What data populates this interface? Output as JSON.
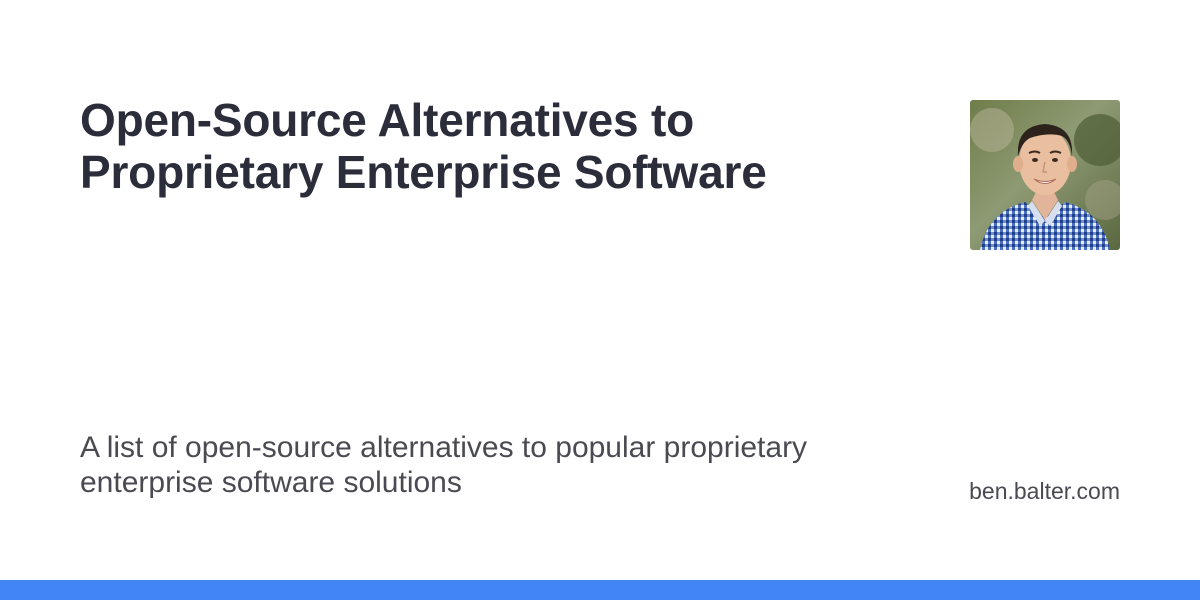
{
  "card": {
    "title": "Open-Source Alternatives to Proprietary Enterprise Software",
    "description": "A list of open-source alternatives to popular proprietary enterprise software solutions",
    "site": "ben.balter.com",
    "avatar_icon": "author-portrait"
  },
  "colors": {
    "title": "#2b2d3a",
    "text": "#4a4a52",
    "accent": "#4285f4",
    "background": "#ffffff"
  }
}
